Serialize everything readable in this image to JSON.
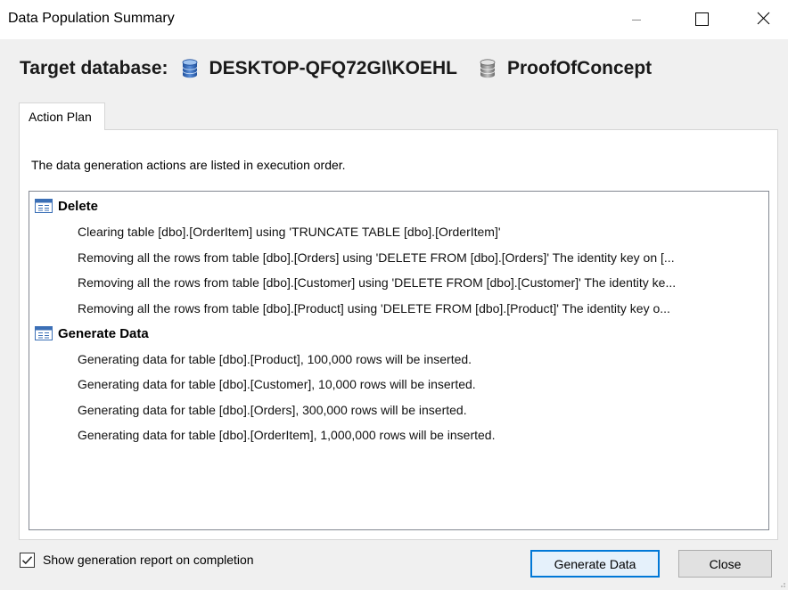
{
  "window": {
    "title": "Data Population Summary"
  },
  "target": {
    "label": "Target database:",
    "server": "DESKTOP-QFQ72GI\\KOEHL",
    "database": "ProofOfConcept"
  },
  "tabs": [
    {
      "label": "Action Plan",
      "active": true
    }
  ],
  "plan": {
    "intro": "The data generation actions are listed in execution order.",
    "groups": [
      {
        "title": "Delete",
        "items": [
          "Clearing table [dbo].[OrderItem] using 'TRUNCATE TABLE [dbo].[OrderItem]'",
          "Removing all the rows from table [dbo].[Orders] using 'DELETE  FROM [dbo].[Orders]' The identity key on [...",
          "Removing all the rows from table [dbo].[Customer] using 'DELETE  FROM [dbo].[Customer]' The identity ke...",
          "Removing all the rows from table [dbo].[Product] using 'DELETE  FROM [dbo].[Product]' The identity key o..."
        ]
      },
      {
        "title": "Generate Data",
        "items": [
          "Generating data for table [dbo].[Product], 100,000 rows will be inserted.",
          "Generating data for table [dbo].[Customer], 10,000 rows will be inserted.",
          "Generating data for table [dbo].[Orders], 300,000 rows will be inserted.",
          "Generating data for table [dbo].[OrderItem], 1,000,000 rows will be inserted."
        ]
      }
    ]
  },
  "options": {
    "show_report_label": "Show generation report on completion",
    "show_report_checked": true
  },
  "buttons": {
    "generate": "Generate Data",
    "close": "Close"
  },
  "icons": {
    "database": "database-icon",
    "group": "table-icon",
    "minimize": "minimize-icon",
    "maximize": "maximize-icon",
    "close": "close-icon"
  },
  "colors": {
    "primary_button_border": "#0078d7",
    "primary_button_bg": "#e5f1fb",
    "dialog_bg": "#f0f0f0",
    "list_border": "#828790"
  }
}
